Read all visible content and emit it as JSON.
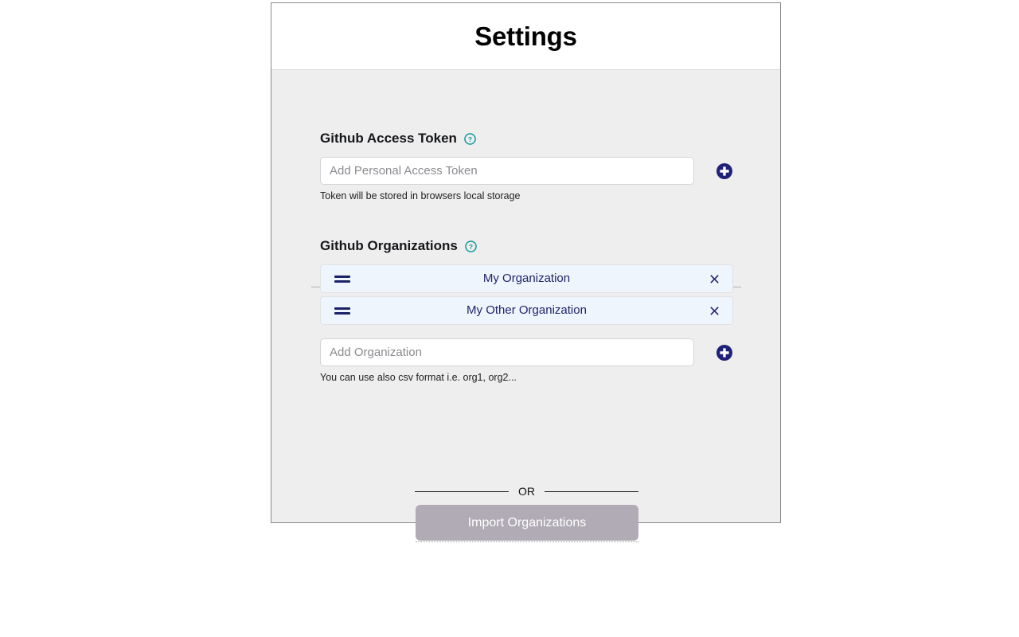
{
  "header": {
    "title": "Settings"
  },
  "colors": {
    "page_background": "#ffffff",
    "card_background": "#eeeeee",
    "header_background": "#ffffff",
    "card_border": "#8a8a8a",
    "help_icon_teal": "#119a9a",
    "add_button_navy": "#1f2178",
    "org_row_background": "#eff5fd",
    "org_text_navy": "#1f2469",
    "import_button_gray": "#b0abb4"
  },
  "token_section": {
    "label": "Github Access Token",
    "help_icon": "help-circle-icon",
    "input": {
      "placeholder": "Add Personal Access Token",
      "value": ""
    },
    "add_icon": "plus-circle-icon",
    "helper_text": "Token will be stored in browsers local storage"
  },
  "organizations_section": {
    "label": "Github Organizations",
    "help_icon": "help-circle-icon",
    "items": [
      {
        "name": "My Organization",
        "drag_icon": "drag-handle-icon",
        "remove_icon": "close-icon"
      },
      {
        "name": "My Other Organization",
        "drag_icon": "drag-handle-icon",
        "remove_icon": "close-icon"
      }
    ],
    "input": {
      "placeholder": "Add Organization",
      "value": ""
    },
    "add_icon": "plus-circle-icon",
    "helper_text": "You can use also csv format i.e. org1, org2..."
  },
  "divider": {
    "or_label": "OR"
  },
  "import": {
    "label": "Import Organizations"
  }
}
